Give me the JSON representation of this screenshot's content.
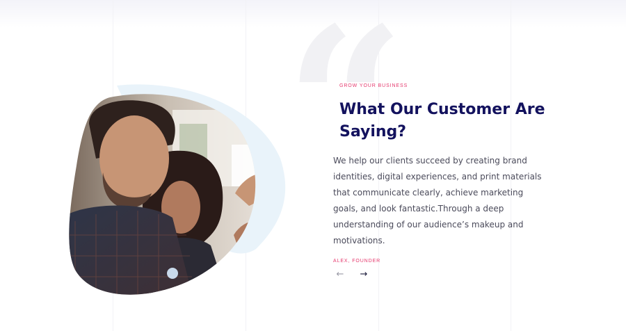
{
  "section": {
    "eyebrow": "GROW YOUR BUSINESS",
    "title": "What Our Customer Are Saying?",
    "body": "We help our clients succeed by creating brand identities, digital experiences, and print materials that communicate clearly, achieve marketing goals, and look fantastic.Through a deep understanding of our audience’s makeup and motivations.",
    "author": "ALEX, FOUNDER"
  },
  "quote_mark": "“",
  "nav": {
    "prev_icon": "←",
    "next_icon": "→"
  },
  "colors": {
    "accent": "#e5386d",
    "heading": "#13125e",
    "body": "#4a4a5a",
    "blob": "#e8f2fa"
  },
  "photo": {
    "description_icon": "testimonial-photo"
  }
}
